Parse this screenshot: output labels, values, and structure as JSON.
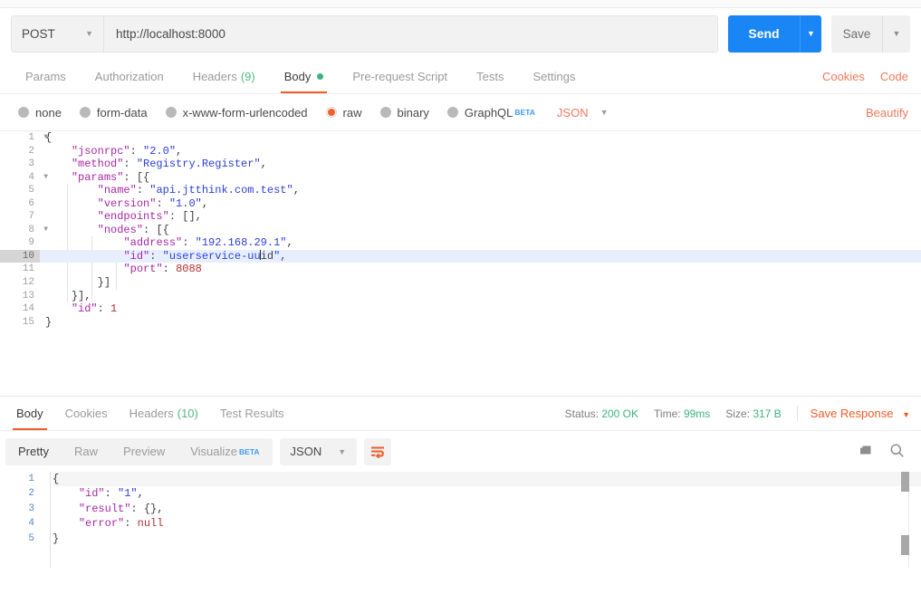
{
  "request": {
    "method": "POST",
    "url": "http://localhost:8000",
    "send_label": "Send",
    "save_label": "Save",
    "tabs": [
      {
        "label": "Params"
      },
      {
        "label": "Authorization"
      },
      {
        "label": "Headers",
        "count": "(9)"
      },
      {
        "label": "Body",
        "active": true
      },
      {
        "label": "Pre-request Script"
      },
      {
        "label": "Tests"
      },
      {
        "label": "Settings"
      }
    ],
    "links": {
      "cookies": "Cookies",
      "code": "Code"
    },
    "body_types": [
      {
        "label": "none"
      },
      {
        "label": "form-data"
      },
      {
        "label": "x-www-form-urlencoded"
      },
      {
        "label": "raw",
        "selected": true
      },
      {
        "label": "binary"
      },
      {
        "label": "GraphQL",
        "badge": "BETA"
      }
    ],
    "format": "JSON",
    "beautify": "Beautify",
    "editor": {
      "lines": [
        {
          "no": "1",
          "fold": true,
          "text": "{"
        },
        {
          "no": "2",
          "text": "    \"jsonrpc\": \"2.0\","
        },
        {
          "no": "3",
          "text": "    \"method\": \"Registry.Register\","
        },
        {
          "no": "4",
          "fold": true,
          "text": "    \"params\": [{"
        },
        {
          "no": "5",
          "text": "        \"name\": \"api.jtthink.com.test\","
        },
        {
          "no": "6",
          "text": "        \"version\": \"1.0\","
        },
        {
          "no": "7",
          "text": "        \"endpoints\": [],"
        },
        {
          "no": "8",
          "fold": true,
          "text": "        \"nodes\": [{"
        },
        {
          "no": "9",
          "text": "            \"address\": \"192.168.29.1\","
        },
        {
          "no": "10",
          "text": "            \"id\": \"userservice-uuid\",",
          "current": true
        },
        {
          "no": "11",
          "text": "            \"port\": 8088"
        },
        {
          "no": "12",
          "text": "        }]"
        },
        {
          "no": "13",
          "text": "    }],"
        },
        {
          "no": "14",
          "text": "    \"id\": 1"
        },
        {
          "no": "15",
          "text": "}"
        }
      ]
    }
  },
  "response": {
    "tabs": [
      {
        "label": "Body",
        "active": true
      },
      {
        "label": "Cookies"
      },
      {
        "label": "Headers",
        "count": "(10)"
      },
      {
        "label": "Test Results"
      }
    ],
    "status_label": "Status:",
    "status_value": "200 OK",
    "time_label": "Time:",
    "time_value": "99ms",
    "size_label": "Size:",
    "size_value": "317 B",
    "save_response": "Save Response",
    "view_modes": [
      {
        "label": "Pretty",
        "active": true
      },
      {
        "label": "Raw"
      },
      {
        "label": "Preview"
      },
      {
        "label": "Visualize",
        "badge": "BETA"
      }
    ],
    "format": "JSON",
    "body_lines": [
      {
        "no": "1",
        "text": "{"
      },
      {
        "no": "2",
        "text": "    \"id\": \"1\","
      },
      {
        "no": "3",
        "text": "    \"result\": {},"
      },
      {
        "no": "4",
        "text": "    \"error\": null"
      },
      {
        "no": "5",
        "text": "}"
      }
    ]
  },
  "colors": {
    "accent_orange": "#ef5b25",
    "send_blue": "#1a86f5",
    "status_green": "#3ab47e",
    "link_orange": "#f0795b"
  }
}
